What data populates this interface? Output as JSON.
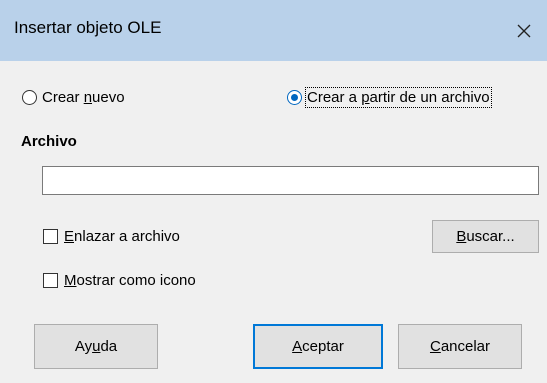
{
  "window": {
    "title": "Insertar objeto OLE",
    "close_glyph": "close-icon"
  },
  "options": {
    "create_new": {
      "pre": "Crear ",
      "accel": "n",
      "post": "uevo",
      "checked": false
    },
    "create_from_file": {
      "pre": "Crear a ",
      "accel": "p",
      "post": "artir de un archivo",
      "checked": true
    }
  },
  "file_section": {
    "label": "Archivo",
    "path_value": "",
    "link_to_file": {
      "pre": "",
      "accel": "E",
      "post": "nlazar a archivo",
      "checked": false
    },
    "show_as_icon": {
      "pre": "",
      "accel": "M",
      "post": "ostrar como icono",
      "checked": false
    },
    "browse_button": {
      "pre": "",
      "accel": "B",
      "post": "uscar..."
    }
  },
  "buttons": {
    "help": {
      "pre": "Ay",
      "accel": "u",
      "post": "da"
    },
    "ok": {
      "pre": "",
      "accel": "A",
      "post": "ceptar"
    },
    "cancel": {
      "pre": "",
      "accel": "C",
      "post": "ancelar"
    }
  },
  "colors": {
    "titlebar": "#b9d1ea",
    "accent": "#0078d7",
    "background": "#f0f0f0"
  }
}
